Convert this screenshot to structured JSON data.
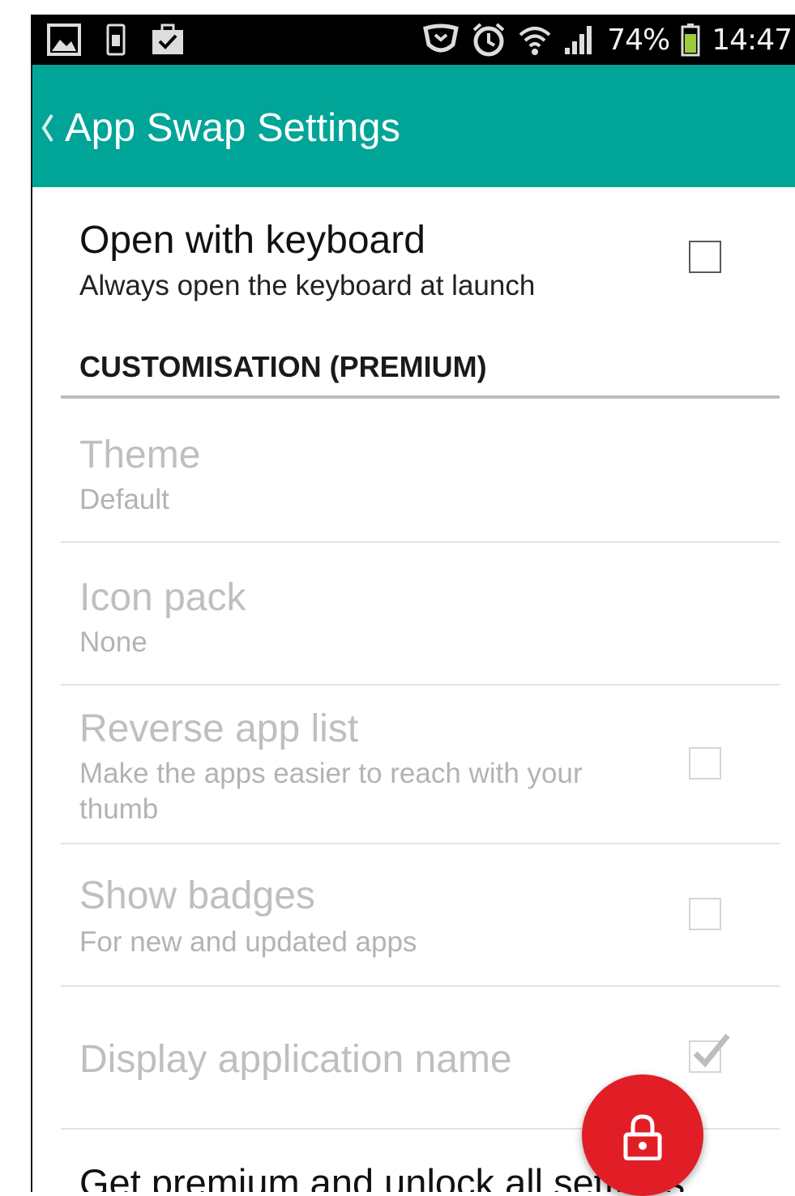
{
  "statusbar": {
    "left_icons": [
      "image-icon",
      "phone-charging-icon",
      "briefcase-check-icon"
    ],
    "right_icons": [
      "shield-icon",
      "alarm-icon",
      "wifi-icon",
      "signal-icon",
      "battery-icon"
    ],
    "battery_percent": "74%",
    "time": "14:47"
  },
  "appbar": {
    "title": "App Swap Settings",
    "color": "#00a597"
  },
  "settings": {
    "open_with_keyboard": {
      "title": "Open with keyboard",
      "summary": "Always open the keyboard at launch",
      "checked": false
    },
    "section_header": "CUSTOMISATION (PREMIUM)",
    "theme": {
      "title": "Theme",
      "summary": "Default"
    },
    "icon_pack": {
      "title": "Icon pack",
      "summary": "None"
    },
    "reverse_app_list": {
      "title": "Reverse app list",
      "summary_line1": "Make the apps easier to reach with your",
      "summary_line2": "thumb",
      "checked": false
    },
    "show_badges": {
      "title": "Show badges",
      "summary": "For new and updated apps",
      "checked": false
    },
    "display_app_name": {
      "title": "Display application name",
      "checked": true
    },
    "get_premium": {
      "title": "Get premium and unlock all settings"
    }
  },
  "fab": {
    "icon": "lock-icon",
    "color": "#e11e26"
  }
}
